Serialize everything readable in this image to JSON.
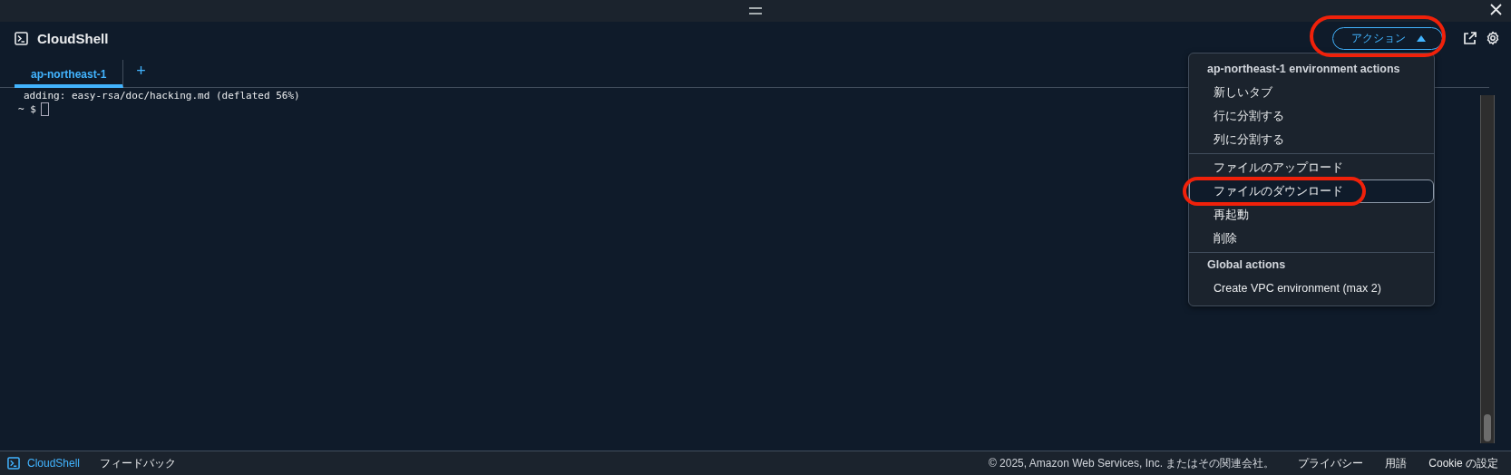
{
  "app": {
    "title": "CloudShell"
  },
  "tabs": [
    {
      "label": "ap-northeast-1",
      "selected": true
    },
    {
      "label": "+",
      "kind": "add",
      "selected": false
    }
  ],
  "actions_button": {
    "label": "アクション",
    "expanded": true,
    "highlighted": true
  },
  "terminal": {
    "lines": [
      "adding: easy-rsa/doc/hacking.md (deflated 56%)"
    ],
    "prompt": "~ $"
  },
  "menu": {
    "sections": [
      {
        "title": "ap-northeast-1 environment actions",
        "items": [
          {
            "label": "新しいタブ",
            "selected": false,
            "highlighted": false
          },
          {
            "label": "行に分割する",
            "selected": false,
            "highlighted": false
          },
          {
            "label": "列に分割する",
            "selected": false,
            "highlighted": false
          }
        ]
      },
      {
        "items": [
          {
            "label": "ファイルのアップロード",
            "selected": false,
            "highlighted": false
          },
          {
            "label": "ファイルのダウンロード",
            "selected": true,
            "highlighted": true
          },
          {
            "label": "再起動",
            "selected": false,
            "highlighted": false
          },
          {
            "label": "削除",
            "selected": false,
            "highlighted": false
          }
        ]
      },
      {
        "title": "Global actions",
        "items": [
          {
            "label": "Create VPC environment (max 2)",
            "selected": false,
            "highlighted": false
          }
        ]
      }
    ]
  },
  "footer": {
    "brand": "CloudShell",
    "feedback": "フィードバック",
    "copyright": "© 2025, Amazon Web Services, Inc. またはその関連会社。",
    "links": [
      "プライバシー",
      "用語",
      "Cookie の設定"
    ]
  }
}
